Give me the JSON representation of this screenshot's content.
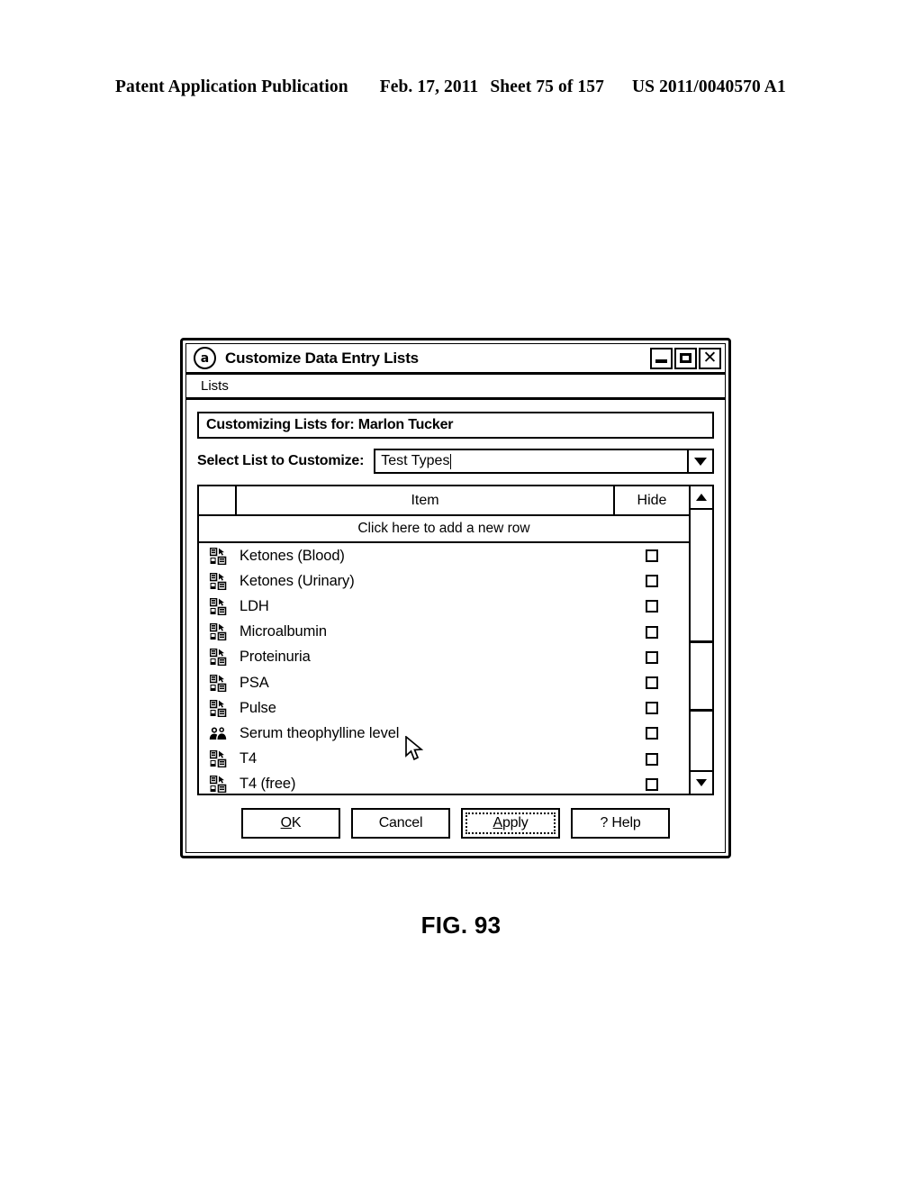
{
  "page": {
    "header": {
      "publication": "Patent Application Publication",
      "date": "Feb. 17, 2011",
      "sheet": "Sheet 75 of 157",
      "number": "US 2011/0040570 A1"
    },
    "figure_caption": "FIG. 93"
  },
  "dialog": {
    "app_icon": "a",
    "title": "Customize Data Entry Lists",
    "window_buttons": [
      {
        "name": "minimize",
        "label": "—"
      },
      {
        "name": "maximize",
        "label": "□"
      },
      {
        "name": "close",
        "label": "✕"
      }
    ],
    "menubar": {
      "items": [
        {
          "label": "Lists"
        }
      ]
    },
    "customizing_banner": "Customizing Lists for: Marlon Tucker",
    "select_list": {
      "label": "Select List to Customize:",
      "value": "Test Types",
      "placeholder": "Test Types",
      "options": [
        "Test Types"
      ]
    },
    "grid": {
      "columns": {
        "selector": "",
        "item": "Item",
        "hide": "Hide"
      },
      "new_row_prompt": "Click here to add a new row",
      "rows": [
        {
          "icon": "record-icon",
          "item": "Ketones (Blood)",
          "hide": false
        },
        {
          "icon": "record-icon",
          "item": "Ketones (Urinary)",
          "hide": false
        },
        {
          "icon": "record-icon",
          "item": "LDH",
          "hide": false
        },
        {
          "icon": "record-icon",
          "item": "Microalbumin",
          "hide": false
        },
        {
          "icon": "record-icon",
          "item": "Proteinuria",
          "hide": false
        },
        {
          "icon": "record-icon",
          "item": "PSA",
          "hide": false
        },
        {
          "icon": "record-icon",
          "item": "Pulse",
          "hide": false
        },
        {
          "icon": "people-icon",
          "item": "Serum theophylline level",
          "hide": false
        },
        {
          "icon": "record-icon",
          "item": "T4",
          "hide": false
        },
        {
          "icon": "record-icon",
          "item": "T4 (free)",
          "hide": false
        }
      ],
      "scrollbar": {
        "up_arrow": "▲",
        "down_arrow": "▼"
      }
    },
    "buttons": [
      {
        "name": "ok-button",
        "label": "OK",
        "accel": "O",
        "focused": false
      },
      {
        "name": "cancel-button",
        "label": "Cancel",
        "accel": "",
        "focused": false
      },
      {
        "name": "apply-button",
        "label": "Apply",
        "accel": "A",
        "focused": true
      },
      {
        "name": "help-button",
        "label": "? Help",
        "accel": "",
        "focused": false
      }
    ]
  },
  "colors": {
    "ink": "#000000",
    "paper": "#ffffff"
  }
}
